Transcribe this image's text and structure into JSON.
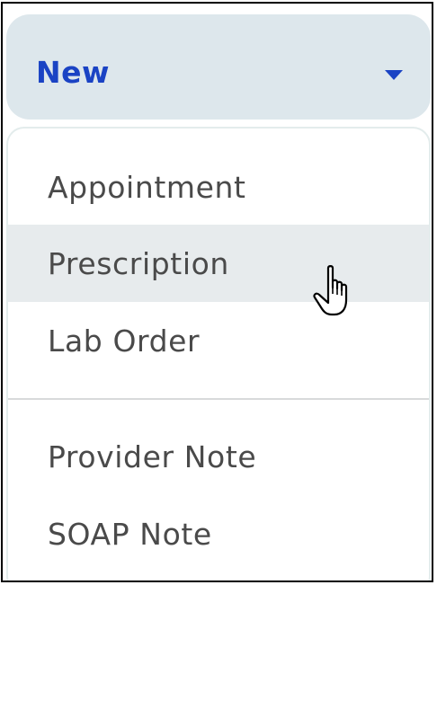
{
  "new_button": {
    "label": "New",
    "background": "#dde7ec",
    "label_color": "#1a43c4"
  },
  "menu": {
    "items": [
      {
        "label": "Appointment",
        "hovered": false
      },
      {
        "label": "Prescription",
        "hovered": true
      },
      {
        "label": "Lab Order",
        "hovered": false
      },
      {
        "label": "Provider Note",
        "hovered": false
      },
      {
        "label": "SOAP Note",
        "hovered": false
      }
    ]
  },
  "cursor": {
    "icon": "hand-pointer-icon"
  }
}
